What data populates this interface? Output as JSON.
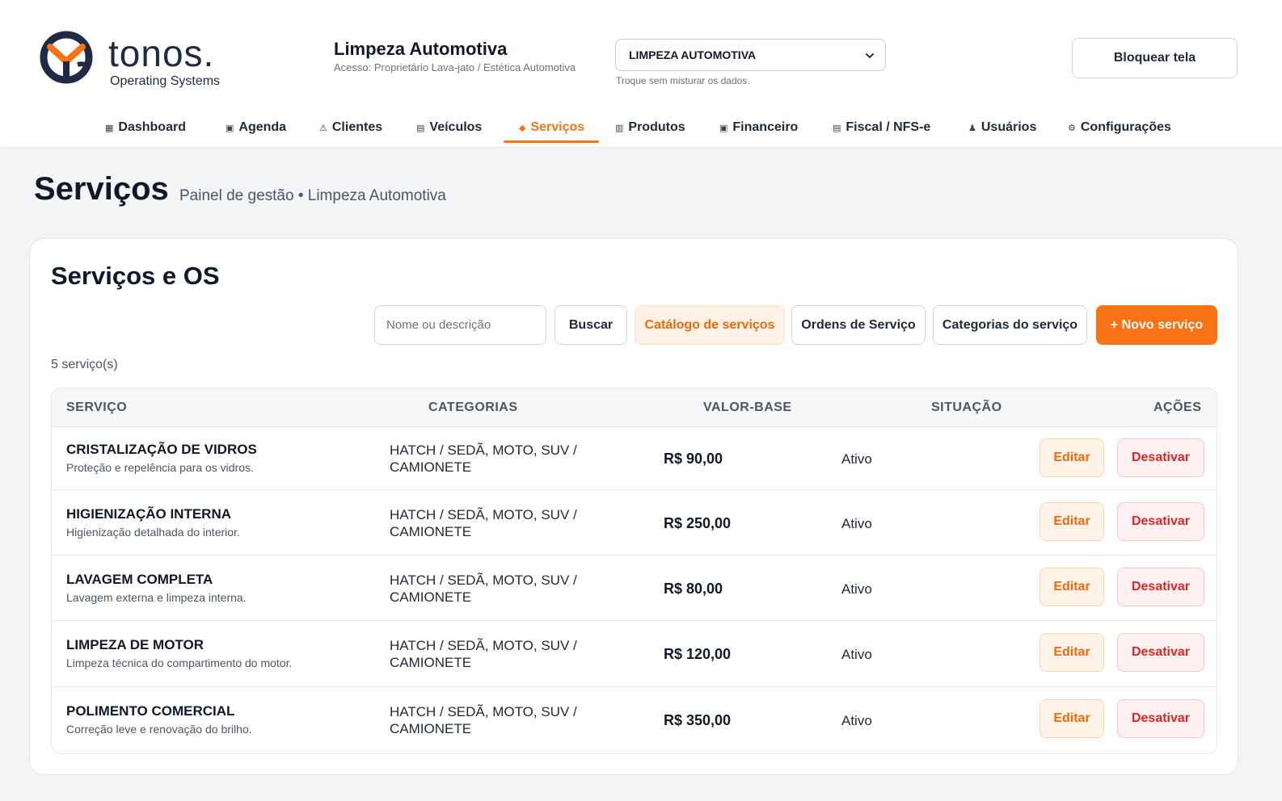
{
  "brand": {
    "logo_word": "tonos.",
    "logo_sub": "Operating Systems",
    "title": "Limpeza Automotiva",
    "access": "Acesso: Proprietário Lava-jato / Estética Automotiva"
  },
  "tenant": {
    "selected": "LIMPEZA AUTOMOTIVA",
    "hint": "Troque sem misturar os dados."
  },
  "lock_button": "Bloquear tela",
  "nav": [
    {
      "label": "Dashboard",
      "icon": "▦"
    },
    {
      "label": "Agenda",
      "icon": "▣"
    },
    {
      "label": "Clientes",
      "icon": "⚠"
    },
    {
      "label": "Veículos",
      "icon": "▤"
    },
    {
      "label": "Serviços",
      "icon": "◆"
    },
    {
      "label": "Produtos",
      "icon": "▥"
    },
    {
      "label": "Financeiro",
      "icon": "▣"
    },
    {
      "label": "Fiscal / NFS-e",
      "icon": "▤"
    },
    {
      "label": "Usuários",
      "icon": "♟"
    },
    {
      "label": "Configurações",
      "icon": "⚙"
    }
  ],
  "active_nav": "Serviços",
  "page": {
    "title": "Serviços",
    "subtitle": "Painel de gestão • Limpeza Automotiva"
  },
  "card": {
    "title": "Serviços e OS",
    "search_placeholder": "Nome ou descrição",
    "search_button": "Buscar",
    "catalog_button": "Catálogo de serviços",
    "orders_button": "Ordens de Serviço",
    "categories_button": "Categorias do serviço",
    "new_button": "+ Novo serviço",
    "count": "5 serviço(s)"
  },
  "table": {
    "headers": {
      "service": "SERVIÇO",
      "categories": "CATEGORIAS",
      "price": "VALOR-BASE",
      "status": "SITUAÇÃO",
      "actions": "AÇÕES"
    },
    "edit_label": "Editar",
    "disable_label": "Desativar",
    "rows": [
      {
        "name": "CRISTALIZAÇÃO DE VIDROS",
        "desc": "Proteção e repelência para os vidros.",
        "cat1": "HATCH / SEDÃ, MOTO, SUV /",
        "cat2": "CAMIONETE",
        "price": "R$ 90,00",
        "status": "Ativo"
      },
      {
        "name": "HIGIENIZAÇÃO INTERNA",
        "desc": "Higienização detalhada do interior.",
        "cat1": "HATCH / SEDÃ, MOTO, SUV /",
        "cat2": "CAMIONETE",
        "price": "R$ 250,00",
        "status": "Ativo"
      },
      {
        "name": "LAVAGEM COMPLETA",
        "desc": "Lavagem externa e limpeza interna.",
        "cat1": "HATCH / SEDÃ, MOTO, SUV /",
        "cat2": "CAMIONETE",
        "price": "R$ 80,00",
        "status": "Ativo"
      },
      {
        "name": "LIMPEZA DE MOTOR",
        "desc": "Limpeza técnica do compartimento do motor.",
        "cat1": "HATCH / SEDÃ, MOTO, SUV /",
        "cat2": "CAMIONETE",
        "price": "R$ 120,00",
        "status": "Ativo"
      },
      {
        "name": "POLIMENTO COMERCIAL",
        "desc": "Correção leve e renovação do brilho.",
        "cat1": "HATCH / SEDÃ, MOTO, SUV /",
        "cat2": "CAMIONETE",
        "price": "R$ 350,00",
        "status": "Ativo"
      }
    ]
  },
  "colors": {
    "accent": "#f97316",
    "danger": "#dc2626",
    "ink": "#111827"
  }
}
